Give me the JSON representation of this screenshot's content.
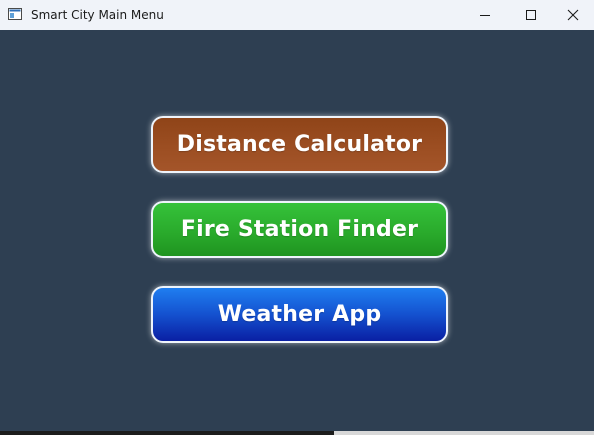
{
  "window": {
    "title": "Smart City Main Menu",
    "icon": "app-window-icon",
    "controls": {
      "minimize_icon": "minimize-icon",
      "maximize_icon": "maximize-icon",
      "close_icon": "close-icon"
    }
  },
  "menu": {
    "buttons": [
      {
        "label": "Distance Calculator",
        "color": "#9a4b20"
      },
      {
        "label": "Fire Station Finder",
        "color": "#2bab2d"
      },
      {
        "label": "Weather App",
        "color": "#1451cf"
      }
    ]
  },
  "colors": {
    "background": "#2e3f52",
    "titlebar": "#f0f3f9",
    "button_border": "#eef4fb"
  }
}
